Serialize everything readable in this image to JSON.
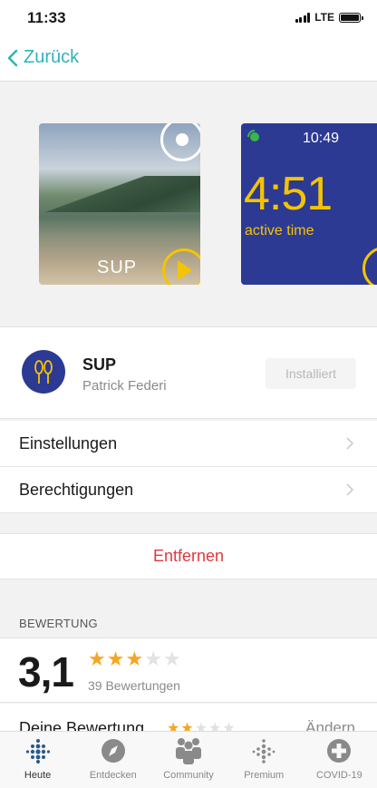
{
  "status_bar": {
    "time": "11:33",
    "network": "LTE"
  },
  "nav": {
    "back_label": "Zurück"
  },
  "gallery": {
    "shot1_label": "SUP",
    "shot2_clock": "10:49",
    "shot2_value": "4:51",
    "shot2_caption": "active time"
  },
  "app": {
    "name": "SUP",
    "author": "Patrick Federi",
    "install_button": "Installiert",
    "icon": "paddle-icon"
  },
  "list": [
    {
      "label": "Einstellungen"
    },
    {
      "label": "Berechtigungen"
    }
  ],
  "remove_label": "Entfernen",
  "rating": {
    "section_title": "BEWERTUNG",
    "score": "3,1",
    "stars_filled": 3,
    "stars_total": 5,
    "count_text": "39 Bewertungen",
    "your_rating_label": "Deine Bewertung",
    "your_stars_filled": 2,
    "change_label": "Ändern"
  },
  "tabs": [
    {
      "label": "Heute",
      "icon": "dots-grid-icon",
      "active": true
    },
    {
      "label": "Entdecken",
      "icon": "compass-icon",
      "active": false
    },
    {
      "label": "Community",
      "icon": "community-icon",
      "active": false
    },
    {
      "label": "Premium",
      "icon": "premium-dots-icon",
      "active": false
    },
    {
      "label": "COVID-19",
      "icon": "plus-circle-icon",
      "active": false
    }
  ],
  "colors": {
    "accent": "#2fb3b8",
    "danger": "#e0383e",
    "star": "#f5a623",
    "watch_bg": "#2c3a94"
  }
}
